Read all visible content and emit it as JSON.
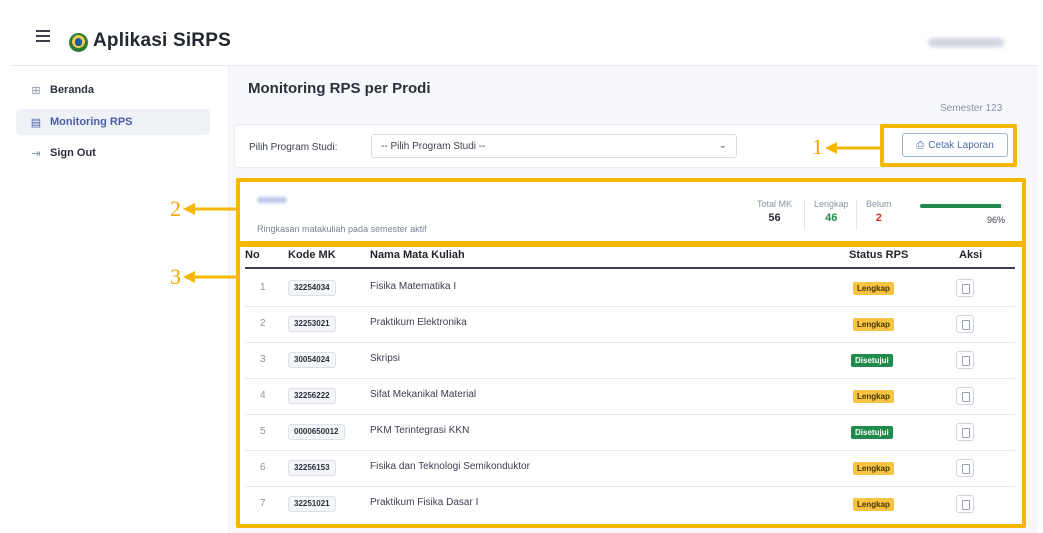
{
  "app": {
    "title": "Aplikasi SiRPS",
    "menu_icon": "hamburger-icon",
    "logo": "university-logo"
  },
  "sidebar": {
    "items": [
      {
        "label": "Beranda",
        "icon": "grid-icon",
        "icon_glyph": "⊞",
        "active": false
      },
      {
        "label": "Monitoring RPS",
        "icon": "document-icon",
        "icon_glyph": "▤",
        "active": true
      },
      {
        "label": "Sign Out",
        "icon": "sign-out-icon",
        "icon_glyph": "⇥",
        "active": false
      }
    ]
  },
  "main": {
    "title": "Monitoring RPS per Prodi",
    "semester": "Semester 123",
    "filter": {
      "label": "Pilih Program Studi:",
      "value": "-- Pilih Program Studi --"
    },
    "print_button": {
      "label": "Cetak Laporan",
      "icon": "printer-icon"
    }
  },
  "summary": {
    "caption": "Ringkasan matakuliah pada semester aktif",
    "stats": [
      {
        "label": "Total MK",
        "value": "56",
        "color": "#2b2f3a"
      },
      {
        "label": "Lengkap",
        "value": "46",
        "color": "#1f8a4c"
      },
      {
        "label": "Belum",
        "value": "2",
        "color": "#d93025"
      }
    ],
    "progress_label": "96%",
    "progress_fraction": 0.96,
    "progress_color": "#1f8a4c"
  },
  "table": {
    "headers": {
      "no": "No",
      "code": "Kode MK",
      "name": "Nama Mata Kuliah",
      "status": "Status RPS",
      "action": "Aksi"
    },
    "rows": [
      {
        "no": "1",
        "code": "32254034",
        "name": "Fisika Matematika I",
        "status": "Lengkap"
      },
      {
        "no": "2",
        "code": "32253021",
        "name": "Praktikum Elektronika",
        "status": "Lengkap"
      },
      {
        "no": "3",
        "code": "30054024",
        "name": "Skripsi",
        "status": "Disetujui"
      },
      {
        "no": "4",
        "code": "32256222",
        "name": "Sifat Mekanikal Material",
        "status": "Lengkap"
      },
      {
        "no": "5",
        "code": "0000650012",
        "name": "PKM Terintegrasi KKN",
        "status": "Disetujui"
      },
      {
        "no": "6",
        "code": "32256153",
        "name": "Fisika dan Teknologi Semikonduktor",
        "status": "Lengkap"
      },
      {
        "no": "7",
        "code": "32251021",
        "name": "Praktikum Fisika Dasar I",
        "status": "Lengkap"
      }
    ]
  },
  "annotations": {
    "labels": [
      "1",
      "2",
      "3"
    ],
    "color": "#f5b800"
  }
}
